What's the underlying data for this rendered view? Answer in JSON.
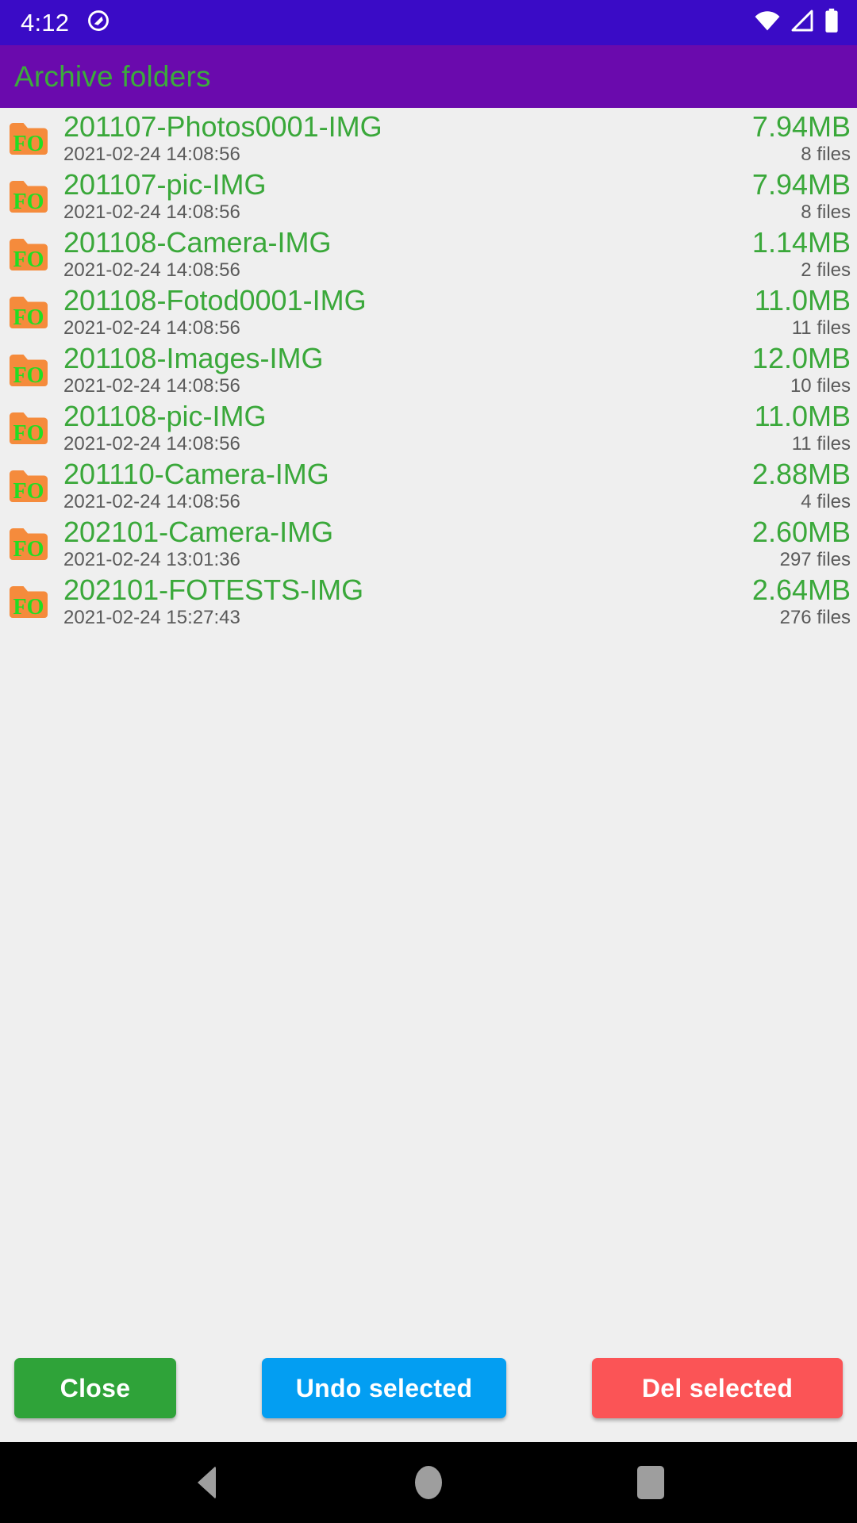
{
  "status_bar": {
    "time": "4:12",
    "left_icon": "android-q-logo-icon",
    "icons": [
      "wifi-icon",
      "cellular-signal-icon",
      "battery-full-icon"
    ],
    "background_color": "#3a0bc6",
    "foreground_color": "#ffffff"
  },
  "title_bar": {
    "title": "Archive folders",
    "background_color": "#6a0aad",
    "title_color": "#3cab3c"
  },
  "list": {
    "background_color": "#efefef",
    "icon_label": "FO",
    "rows": [
      {
        "name": "201107-Photos0001-IMG",
        "date": "2021-02-24 14:08:56",
        "size": "7.94MB",
        "files": "8 files"
      },
      {
        "name": "201107-pic-IMG",
        "date": "2021-02-24 14:08:56",
        "size": "7.94MB",
        "files": "8 files"
      },
      {
        "name": "201108-Camera-IMG",
        "date": "2021-02-24 14:08:56",
        "size": "1.14MB",
        "files": "2 files"
      },
      {
        "name": "201108-Fotod0001-IMG",
        "date": "2021-02-24 14:08:56",
        "size": "11.0MB",
        "files": "11 files"
      },
      {
        "name": "201108-Images-IMG",
        "date": "2021-02-24 14:08:56",
        "size": "12.0MB",
        "files": "10 files"
      },
      {
        "name": "201108-pic-IMG",
        "date": "2021-02-24 14:08:56",
        "size": "11.0MB",
        "files": "11 files"
      },
      {
        "name": "201110-Camera-IMG",
        "date": "2021-02-24 14:08:56",
        "size": "2.88MB",
        "files": "4 files"
      },
      {
        "name": "202101-Camera-IMG",
        "date": "2021-02-24 13:01:36",
        "size": "2.60MB",
        "files": "297 files"
      },
      {
        "name": "202101-FOTESTS-IMG",
        "date": "2021-02-24 15:27:43",
        "size": "2.64MB",
        "files": "276 files"
      }
    ]
  },
  "buttons": {
    "close": {
      "label": "Close",
      "color": "#2fa339"
    },
    "undo": {
      "label": "Undo selected",
      "color": "#039ef2"
    },
    "delete": {
      "label": "Del selected",
      "color": "#fb5456"
    }
  },
  "nav_bar": {
    "back": "back-icon",
    "home": "home-icon",
    "recents": "recents-icon",
    "background_color": "#000000",
    "icon_color": "#9e9e9e"
  },
  "colors": {
    "folder_orange": "#f58b3c",
    "folder_letters_green": "#22dd22",
    "accent_green": "#3aa83a",
    "secondary_text": "#5a5a5a"
  }
}
